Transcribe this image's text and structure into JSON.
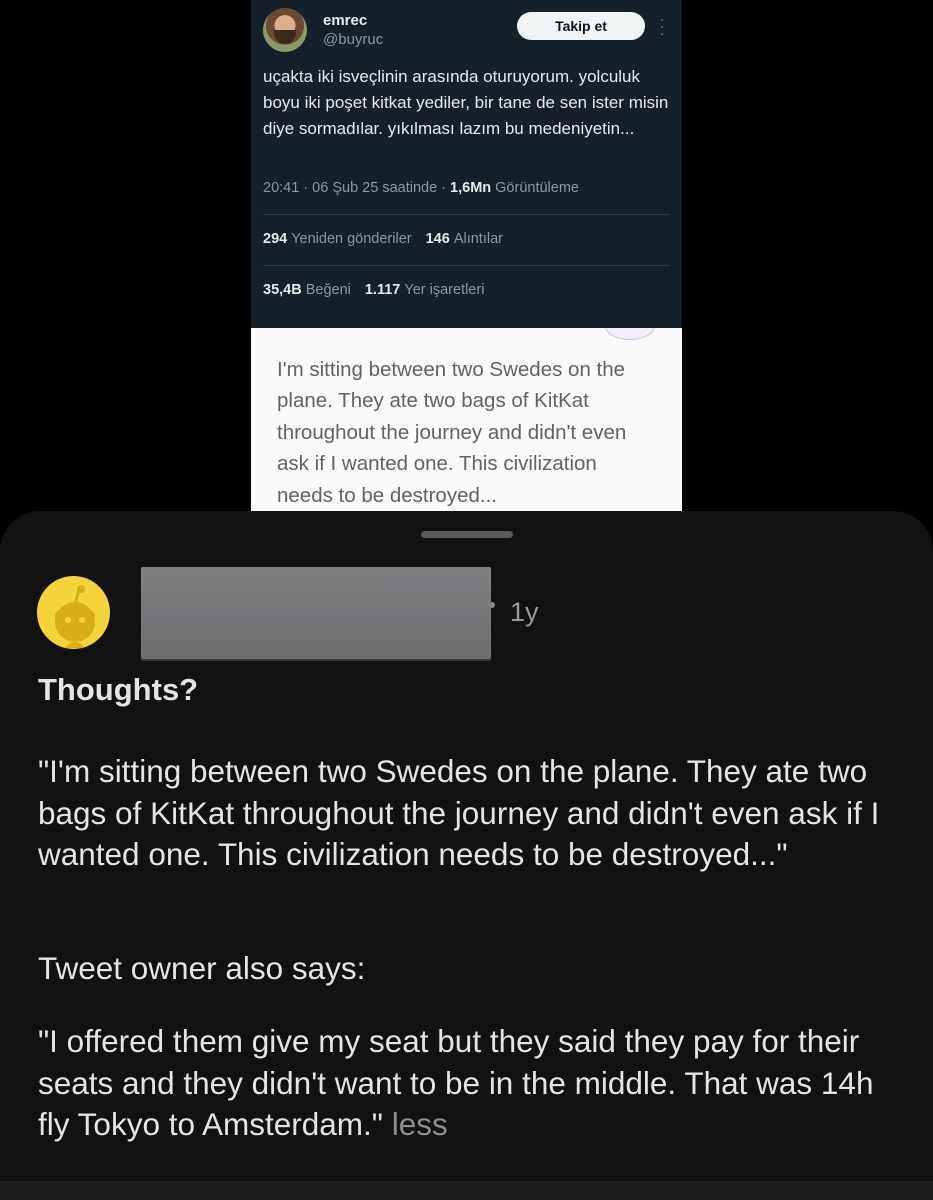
{
  "tweet": {
    "display_name": "emrec",
    "handle": "@buyruc",
    "follow_label": "Takip et",
    "text": "uçakta iki isveçlinin arasında oturuyorum. yolculuk boyu iki poşet kitkat yediler, bir tane de sen ister misin diye sormadılar. yıkılması lazım bu medeniyetin...",
    "timestamp": "20:41 · 06 Şub 25 saatinde · ",
    "views_count": "1,6Mn",
    "views_label": " Görüntüleme",
    "reposts_count": "294",
    "reposts_label": "Yeniden gönderiler",
    "quotes_count": "146",
    "quotes_label": "Alıntılar",
    "likes_count": "35,4B",
    "likes_label": "Beğeni",
    "bookmarks_count": "1.117",
    "bookmarks_label": "Yer işaretleri"
  },
  "translation": {
    "text": "I'm sitting between two Swedes on the plane. They ate two bags of KitKat throughout the journey and didn't even ask if I wanted one. This civilization needs to be destroyed..."
  },
  "reddit_post": {
    "age": "1y",
    "title": "Thoughts?",
    "quote": "\"I'm sitting between two Swedes on the plane. They ate two bags of KitKat throughout the journey and didn't even ask if I wanted one. This civilization needs to be destroyed...\"",
    "owner_note": "Tweet owner also says:",
    "owner_quote": "\"I offered them give my seat but they said they pay for their seats and they didn't want to be in the middle. That was 14h fly Tokyo to Amsterdam.\"",
    "less_label": "less"
  },
  "colors": {
    "tweet_bg": "#15202b",
    "sheet_bg": "#121212",
    "avatar_yellow": "#f5d33b"
  },
  "icons": {
    "tweet_more": "more-vertical-icon",
    "reddit_avatar": "snoo-avatar-icon"
  }
}
